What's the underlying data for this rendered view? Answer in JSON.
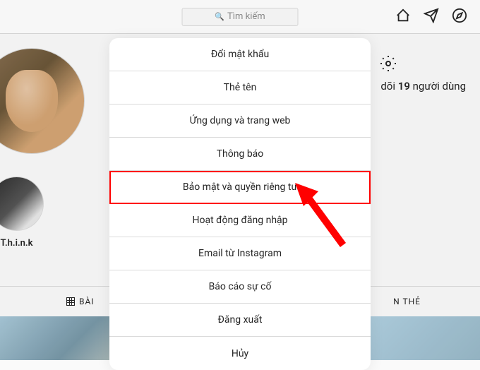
{
  "header": {
    "search_placeholder": "Tìm kiếm"
  },
  "profile": {
    "follow_text_prefix": "dõi",
    "follow_count": "19",
    "follow_text_suffix": "người dùng",
    "story_label": "T.h.i.n.k"
  },
  "tabs": {
    "posts_label": "BÀI",
    "tagged_label": "N THẺ"
  },
  "modal": {
    "items": [
      {
        "label": "Đổi mật khẩu",
        "highlighted": false
      },
      {
        "label": "Thẻ tên",
        "highlighted": false
      },
      {
        "label": "Ứng dụng và trang web",
        "highlighted": false
      },
      {
        "label": "Thông báo",
        "highlighted": false
      },
      {
        "label": "Bảo mật và quyền riêng tư",
        "highlighted": true
      },
      {
        "label": "Hoạt động đăng nhập",
        "highlighted": false
      },
      {
        "label": "Email từ Instagram",
        "highlighted": false
      },
      {
        "label": "Báo cáo sự cố",
        "highlighted": false
      },
      {
        "label": "Đăng xuất",
        "highlighted": false
      },
      {
        "label": "Hủy",
        "highlighted": false
      }
    ]
  },
  "annotation": {
    "arrow_color": "#ff0000"
  }
}
